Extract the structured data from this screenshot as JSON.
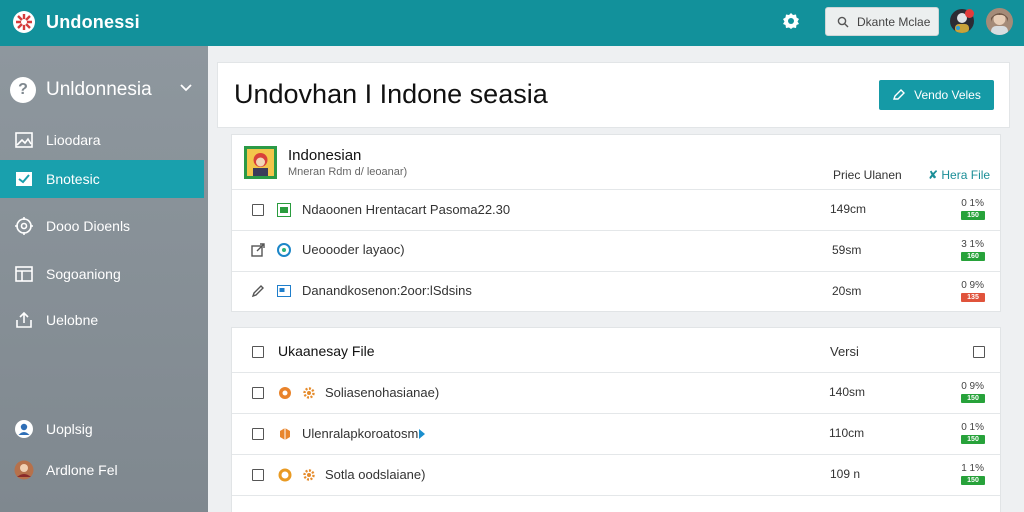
{
  "app": {
    "title": "Undonessi"
  },
  "topbar": {
    "search_text": "Dkante Mclae"
  },
  "sidebar": {
    "header_label": "Unldonnesia",
    "items": [
      {
        "label": "Lioodara",
        "icon": "image-icon",
        "active": false
      },
      {
        "label": "Bnotesic",
        "icon": "check-square-icon",
        "active": true
      },
      {
        "label": "Dooo Dioenls",
        "icon": "puzzle-icon",
        "active": false
      },
      {
        "label": "Sogoaniong",
        "icon": "table-icon",
        "active": false
      },
      {
        "label": "Uelobne",
        "icon": "upload-icon",
        "active": false
      },
      {
        "label": "Uoplsig",
        "icon": "globe-user-icon",
        "active": false
      },
      {
        "label": "Ardlone Fel",
        "icon": "avatar",
        "active": false
      }
    ]
  },
  "header": {
    "title": "Undovhan I Indone seasia",
    "button_label": "Vendo Veles"
  },
  "panel1": {
    "title": "Indonesian",
    "subtitle": "Mneran Rdm d/ leoanar)",
    "col_header_1": "Priec Ulanen",
    "col_header_2": "✘ Hera File",
    "rows": [
      {
        "name": "Ndaoonen Hrentacart Pasoma22.30",
        "size": "149cm",
        "pct": "0 1%",
        "badge": "150",
        "badge_color": "#27a23a"
      },
      {
        "name": "Ueoooder layaoc)",
        "size": "59sm",
        "pct": "3 1%",
        "badge": "160",
        "badge_color": "#27a23a"
      },
      {
        "name": "Danandkosenon:2oor:lSdsins",
        "size": "20sm",
        "pct": "0 9%",
        "badge": "135",
        "badge_color": "#e0533b"
      }
    ]
  },
  "panel2": {
    "title": "Ukaanesay File",
    "col_header": "Versi",
    "rows": [
      {
        "name": "Soliasenohasianae)",
        "size": "140sm",
        "pct": "0 9%",
        "badge": "150",
        "badge_color": "#27a23a"
      },
      {
        "name": "Ulenralapkoroatosm",
        "size": "110cm",
        "pct": "0 1%",
        "badge": "150",
        "badge_color": "#27a23a"
      },
      {
        "name": "Sotla oodslaiane)",
        "size": "109 n",
        "pct": "1 1%",
        "badge": "150",
        "badge_color": "#27a23a"
      }
    ]
  }
}
